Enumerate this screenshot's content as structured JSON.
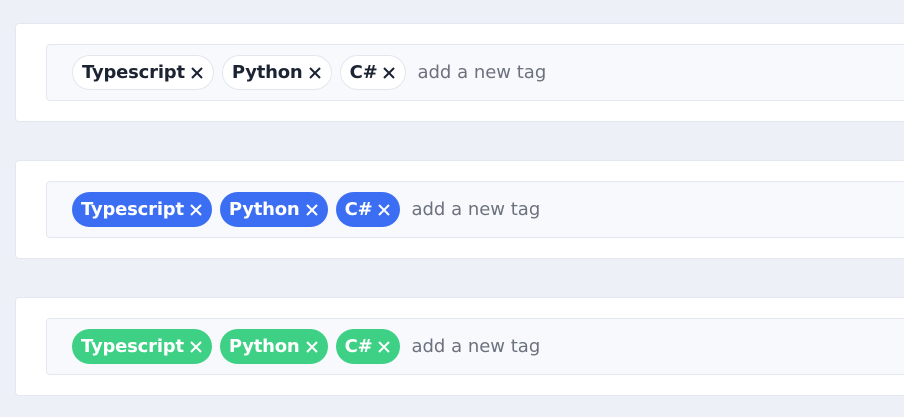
{
  "inputs": [
    {
      "style": "plain",
      "tags": [
        {
          "label": "Typescript",
          "remove_icon": "close-icon"
        },
        {
          "label": "Python",
          "remove_icon": "close-icon"
        },
        {
          "label": "C#",
          "remove_icon": "close-icon"
        }
      ],
      "placeholder": "add a new tag"
    },
    {
      "style": "blue",
      "tag_color": "#3b6ef2",
      "tags": [
        {
          "label": "Typescript",
          "remove_icon": "close-icon"
        },
        {
          "label": "Python",
          "remove_icon": "close-icon"
        },
        {
          "label": "C#",
          "remove_icon": "close-icon"
        }
      ],
      "placeholder": "add a new tag"
    },
    {
      "style": "green",
      "tag_color": "#3ed185",
      "tags": [
        {
          "label": "Typescript",
          "remove_icon": "close-icon"
        },
        {
          "label": "Python",
          "remove_icon": "close-icon"
        },
        {
          "label": "C#",
          "remove_icon": "close-icon"
        }
      ],
      "placeholder": "add a new tag"
    }
  ],
  "colors": {
    "background": "#edf0f7",
    "card": "#ffffff",
    "field": "#f8f9fd",
    "text": "#1c2433"
  }
}
